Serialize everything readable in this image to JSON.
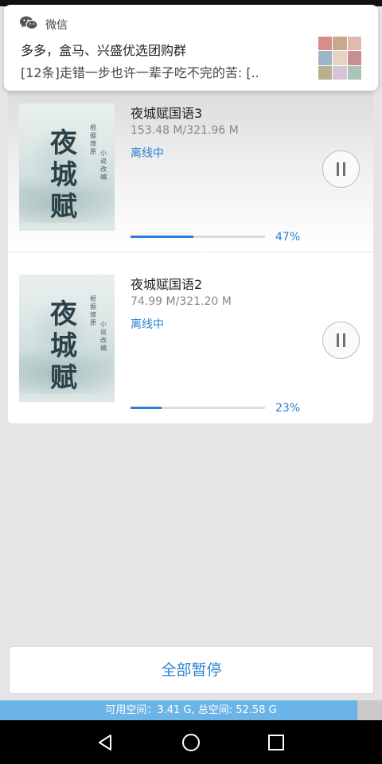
{
  "notification": {
    "app_name": "微信",
    "title": "多多，盒马、兴盛优选团购群",
    "body": "[12条]走错一步也许一辈子吃不完的苦: [..",
    "thumb_colors": [
      "#d98c8c",
      "#caa88a",
      "#e2b9b0",
      "#9db4c9",
      "#e7d3c1",
      "#c78f8f",
      "#b8b08f",
      "#d6c4d8",
      "#a8c5b8"
    ]
  },
  "downloads": [
    {
      "title": "夜城赋国语3",
      "size": "153.48 M/321.96 M",
      "status": "离线中",
      "progress": 0.47,
      "percent": "47%",
      "cover_title": "夜城赋",
      "cover_author": "根据燎原",
      "cover_author2": "小说改编"
    },
    {
      "title": "夜城赋国语2",
      "size": "74.99 M/321.20 M",
      "status": "离线中",
      "progress": 0.23,
      "percent": "23%",
      "cover_title": "夜城赋",
      "cover_author": "根据燎原",
      "cover_author2": "小说改编"
    }
  ],
  "footer": {
    "pause_all_label": "全部暂停",
    "storage_text": "可用空间：3.41 G, 总空间: 52.58 G",
    "storage_used_fraction": 0.935
  },
  "colors": {
    "accent": "#2a82d2",
    "storage_bar": "#6ab4e8"
  },
  "icons": {
    "notification_app": "wechat-icon",
    "pause": "pause-icon",
    "nav_back": "back-triangle-icon",
    "nav_home": "home-circle-icon",
    "nav_recent": "recent-square-icon"
  }
}
